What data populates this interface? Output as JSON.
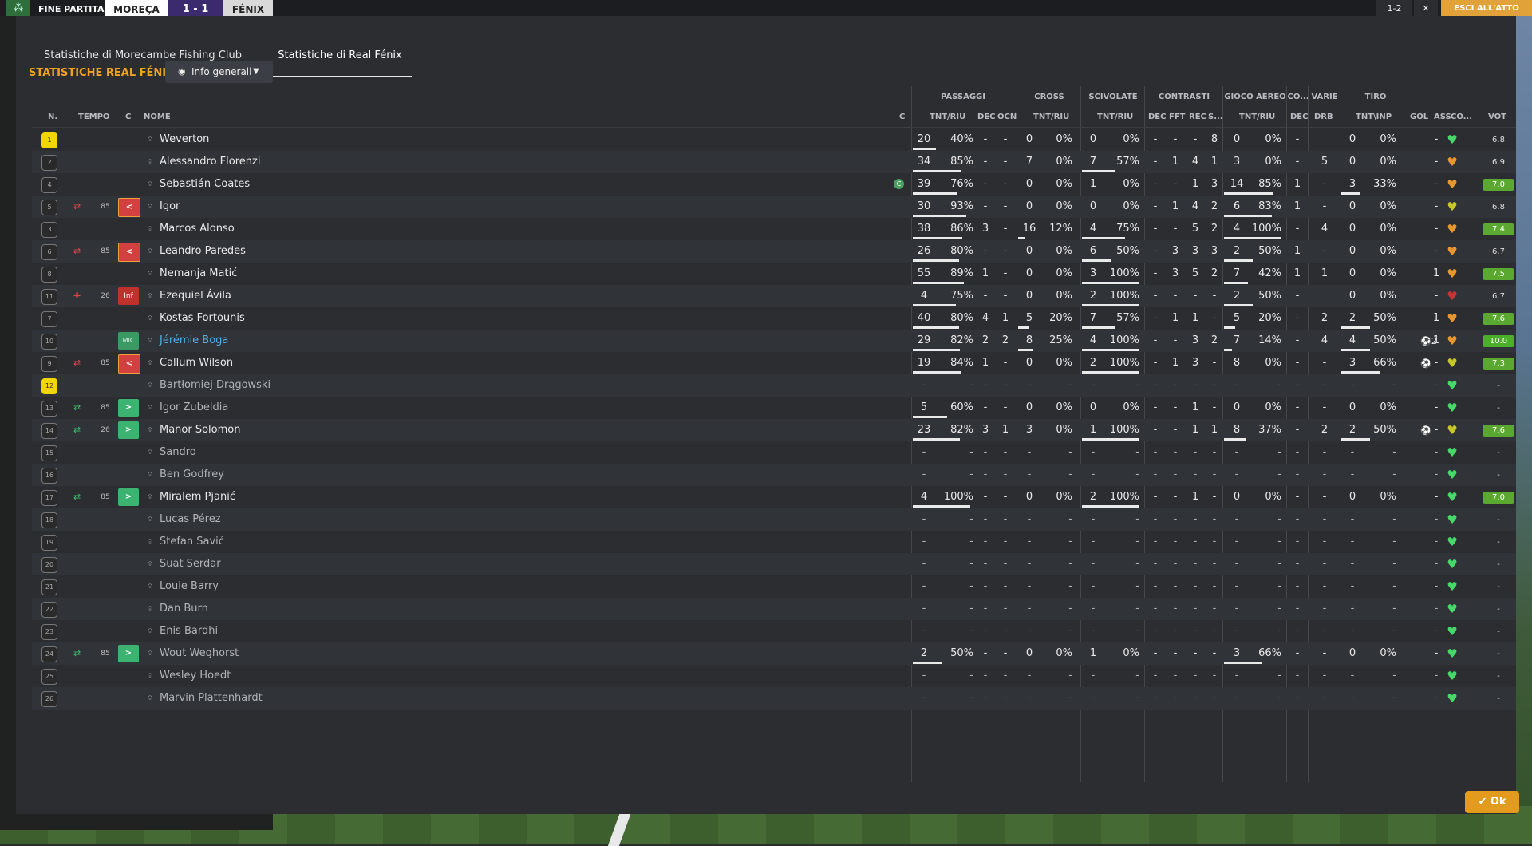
{
  "topbar": {
    "label": "FINE PARTITA",
    "home": "MOREÇA",
    "score": "1 - 1",
    "away": "FÉNIX",
    "right1": "1-2",
    "right2": "✕",
    "right3": "ESCI ALL'ATTO"
  },
  "tabs": [
    "Statistiche di Morecambe Fishing Club",
    "Statistiche di Real Fénix"
  ],
  "team_title": "STATISTICHE REAL FÉNIX",
  "dropdown": {
    "label": "Info generali"
  },
  "groups": {
    "passaggi": "PASSAGGI",
    "cross": "CROSS",
    "scivolate": "SCIVOLATE",
    "contrasti": "CONTRASTI",
    "gioco_aereo": "GIOCO AEREO",
    "co": "CO...",
    "varie": "VARIE",
    "tiro": "TIRO"
  },
  "columns": {
    "n": "N.",
    "tempo": "TEMPO",
    "c": "C",
    "nome": "NOME",
    "c2": "C",
    "pass_tr": "TNT/RIU",
    "pass_dec": "DEC",
    "pass_ocn": "OCN",
    "cross_tr": "TNT/RIU",
    "sciv_tr": "TNT/RIU",
    "con_dec": "DEC",
    "con_fft": "FFT",
    "con_rec": "REC",
    "con_s": "S...",
    "aer_tr": "TNT/RIU",
    "co_dec": "DEC",
    "var_drb": "DRB",
    "tiro_tr": "TNT\\INP",
    "gol": "GOL",
    "ass": "ASS",
    "co2": "CO...",
    "vot": "VOT"
  },
  "players": [
    {
      "n": "1",
      "gk": true,
      "sub": "",
      "min": "",
      "badge": "",
      "name": "Weverton",
      "cap": false,
      "p": [
        "20",
        "40%"
      ],
      "pd": "-",
      "po": "-",
      "cr": [
        "0",
        "0%"
      ],
      "sc": [
        "0",
        "0%"
      ],
      "cd": "-",
      "cf": "-",
      "crc": "-",
      "cs": "8",
      "ae": [
        "0",
        "0%"
      ],
      "cod": "-",
      "drb": "",
      "ti": [
        "0",
        "0%"
      ],
      "gol": "",
      "ass": "-",
      "heart": "green",
      "vot": "6.8",
      "vc": ""
    },
    {
      "n": "2",
      "gk": false,
      "sub": "",
      "min": "",
      "badge": "",
      "name": "Alessandro Florenzi",
      "cap": false,
      "p": [
        "34",
        "85%"
      ],
      "pd": "-",
      "po": "-",
      "cr": [
        "7",
        "0%"
      ],
      "sc": [
        "7",
        "57%"
      ],
      "cd": "-",
      "cf": "1",
      "crc": "4",
      "cs": "1",
      "ae": [
        "3",
        "0%"
      ],
      "cod": "-",
      "drb": "5",
      "ti": [
        "0",
        "0%"
      ],
      "gol": "",
      "ass": "-",
      "heart": "orange",
      "vot": "6.9",
      "vc": ""
    },
    {
      "n": "4",
      "gk": false,
      "sub": "",
      "min": "",
      "badge": "",
      "name": "Sebastián Coates",
      "cap": true,
      "p": [
        "39",
        "76%"
      ],
      "pd": "-",
      "po": "-",
      "cr": [
        "0",
        "0%"
      ],
      "sc": [
        "1",
        "0%"
      ],
      "cd": "-",
      "cf": "-",
      "crc": "1",
      "cs": "3",
      "ae": [
        "14",
        "85%"
      ],
      "cod": "1",
      "drb": "-",
      "ti": [
        "3",
        "33%"
      ],
      "gol": "",
      "ass": "-",
      "heart": "orange",
      "vot": "7.0",
      "vc": "g"
    },
    {
      "n": "5",
      "gk": false,
      "sub": "out",
      "min": "85",
      "badge": "red",
      "name": "Igor",
      "cap": false,
      "p": [
        "30",
        "93%"
      ],
      "pd": "-",
      "po": "-",
      "cr": [
        "0",
        "0%"
      ],
      "sc": [
        "0",
        "0%"
      ],
      "cd": "-",
      "cf": "1",
      "crc": "4",
      "cs": "2",
      "ae": [
        "6",
        "83%"
      ],
      "cod": "1",
      "drb": "-",
      "ti": [
        "0",
        "0%"
      ],
      "gol": "",
      "ass": "-",
      "heart": "yellow",
      "vot": "6.8",
      "vc": ""
    },
    {
      "n": "3",
      "gk": false,
      "sub": "",
      "min": "",
      "badge": "",
      "name": "Marcos Alonso",
      "cap": false,
      "p": [
        "38",
        "86%"
      ],
      "pd": "3",
      "po": "-",
      "cr": [
        "16",
        "12%"
      ],
      "sc": [
        "4",
        "75%"
      ],
      "cd": "-",
      "cf": "-",
      "crc": "5",
      "cs": "2",
      "ae": [
        "4",
        "100%"
      ],
      "cod": "-",
      "drb": "4",
      "ti": [
        "0",
        "0%"
      ],
      "gol": "",
      "ass": "-",
      "heart": "orange",
      "vot": "7.4",
      "vc": "g"
    },
    {
      "n": "6",
      "gk": false,
      "sub": "out",
      "min": "85",
      "badge": "red",
      "name": "Leandro Paredes",
      "cap": false,
      "p": [
        "26",
        "80%"
      ],
      "pd": "-",
      "po": "-",
      "cr": [
        "0",
        "0%"
      ],
      "sc": [
        "6",
        "50%"
      ],
      "cd": "-",
      "cf": "3",
      "crc": "3",
      "cs": "3",
      "ae": [
        "2",
        "50%"
      ],
      "cod": "1",
      "drb": "-",
      "ti": [
        "0",
        "0%"
      ],
      "gol": "",
      "ass": "-",
      "heart": "orange",
      "vot": "6.7",
      "vc": ""
    },
    {
      "n": "8",
      "gk": false,
      "sub": "",
      "min": "",
      "badge": "",
      "name": "Nemanja Matić",
      "cap": false,
      "p": [
        "55",
        "89%"
      ],
      "pd": "1",
      "po": "-",
      "cr": [
        "0",
        "0%"
      ],
      "sc": [
        "3",
        "100%"
      ],
      "cd": "-",
      "cf": "3",
      "crc": "5",
      "cs": "2",
      "ae": [
        "7",
        "42%"
      ],
      "cod": "1",
      "drb": "1",
      "ti": [
        "0",
        "0%"
      ],
      "gol": "",
      "ass": "1",
      "heart": "orange",
      "vot": "7.5",
      "vc": "g"
    },
    {
      "n": "11",
      "gk": false,
      "sub": "inj",
      "min": "26",
      "badge": "inf",
      "name": "Ezequiel Ávila",
      "cap": false,
      "p": [
        "4",
        "75%"
      ],
      "pd": "-",
      "po": "-",
      "cr": [
        "0",
        "0%"
      ],
      "sc": [
        "2",
        "100%"
      ],
      "cd": "-",
      "cf": "-",
      "crc": "-",
      "cs": "-",
      "ae": [
        "2",
        "50%"
      ],
      "cod": "-",
      "drb": "",
      "ti": [
        "0",
        "0%"
      ],
      "gol": "",
      "ass": "-",
      "heart": "red",
      "vot": "6.7",
      "vc": ""
    },
    {
      "n": "7",
      "gk": false,
      "sub": "",
      "min": "",
      "badge": "",
      "name": "Kostas Fortounis",
      "cap": false,
      "p": [
        "40",
        "80%"
      ],
      "pd": "4",
      "po": "1",
      "cr": [
        "5",
        "20%"
      ],
      "sc": [
        "7",
        "57%"
      ],
      "cd": "-",
      "cf": "1",
      "crc": "1",
      "cs": "-",
      "ae": [
        "5",
        "20%"
      ],
      "cod": "-",
      "drb": "2",
      "ti": [
        "2",
        "50%"
      ],
      "gol": "",
      "ass": "1",
      "heart": "orange",
      "vot": "7.6",
      "vc": "g"
    },
    {
      "n": "10",
      "gk": false,
      "sub": "",
      "min": "",
      "badge": "mic",
      "name": "Jérémie Boga",
      "cap": false,
      "p": [
        "29",
        "82%"
      ],
      "pd": "2",
      "po": "2",
      "cr": [
        "8",
        "25%"
      ],
      "sc": [
        "4",
        "100%"
      ],
      "cd": "-",
      "cf": "-",
      "crc": "3",
      "cs": "2",
      "ae": [
        "7",
        "14%"
      ],
      "cod": "-",
      "drb": "4",
      "ti": [
        "4",
        "50%"
      ],
      "gol": "⚽2",
      "ass": "1",
      "heart": "orange",
      "vot": "10.0",
      "vc": "gb"
    },
    {
      "n": "9",
      "gk": false,
      "sub": "out",
      "min": "85",
      "badge": "red",
      "name": "Callum Wilson",
      "cap": false,
      "p": [
        "19",
        "84%"
      ],
      "pd": "1",
      "po": "-",
      "cr": [
        "0",
        "0%"
      ],
      "sc": [
        "2",
        "100%"
      ],
      "cd": "-",
      "cf": "1",
      "crc": "3",
      "cs": "-",
      "ae": [
        "8",
        "0%"
      ],
      "cod": "-",
      "drb": "-",
      "ti": [
        "3",
        "66%"
      ],
      "gol": "⚽",
      "ass": "-",
      "heart": "yellow",
      "vot": "7.3",
      "vc": "g"
    },
    {
      "n": "12",
      "gk": true,
      "sub": "",
      "min": "",
      "badge": "",
      "name": "Bartłomiej Drągowski",
      "cap": false,
      "p": [
        "-",
        "-"
      ],
      "pd": "-",
      "po": "-",
      "cr": [
        "-",
        "-"
      ],
      "sc": [
        "-",
        "-"
      ],
      "cd": "-",
      "cf": "-",
      "crc": "-",
      "cs": "-",
      "ae": [
        "-",
        "-"
      ],
      "cod": "-",
      "drb": "-",
      "ti": [
        "-",
        "-"
      ],
      "gol": "",
      "ass": "-",
      "heart": "green",
      "vot": "-",
      "vc": ""
    },
    {
      "n": "13",
      "gk": false,
      "sub": "in",
      "min": "85",
      "badge": "green",
      "name": "Igor Zubeldia",
      "cap": false,
      "p": [
        "5",
        "60%"
      ],
      "pd": "-",
      "po": "-",
      "cr": [
        "0",
        "0%"
      ],
      "sc": [
        "0",
        "0%"
      ],
      "cd": "-",
      "cf": "-",
      "crc": "1",
      "cs": "-",
      "ae": [
        "0",
        "0%"
      ],
      "cod": "-",
      "drb": "-",
      "ti": [
        "0",
        "0%"
      ],
      "gol": "",
      "ass": "-",
      "heart": "green",
      "vot": "-",
      "vc": ""
    },
    {
      "n": "14",
      "gk": false,
      "sub": "in",
      "min": "26",
      "badge": "green",
      "name": "Manor Solomon",
      "cap": false,
      "p": [
        "23",
        "82%"
      ],
      "pd": "3",
      "po": "1",
      "cr": [
        "3",
        "0%"
      ],
      "sc": [
        "1",
        "100%"
      ],
      "cd": "-",
      "cf": "-",
      "crc": "1",
      "cs": "1",
      "ae": [
        "8",
        "37%"
      ],
      "cod": "-",
      "drb": "2",
      "ti": [
        "2",
        "50%"
      ],
      "gol": "⚽",
      "ass": "-",
      "heart": "yellow",
      "vot": "7.6",
      "vc": "g"
    },
    {
      "n": "15",
      "gk": false,
      "sub": "",
      "min": "",
      "badge": "",
      "name": "Sandro",
      "cap": false,
      "p": [
        "-",
        "-"
      ],
      "pd": "-",
      "po": "-",
      "cr": [
        "-",
        "-"
      ],
      "sc": [
        "-",
        "-"
      ],
      "cd": "-",
      "cf": "-",
      "crc": "-",
      "cs": "-",
      "ae": [
        "-",
        "-"
      ],
      "cod": "-",
      "drb": "-",
      "ti": [
        "-",
        "-"
      ],
      "gol": "",
      "ass": "-",
      "heart": "green",
      "vot": "-",
      "vc": ""
    },
    {
      "n": "16",
      "gk": false,
      "sub": "",
      "min": "",
      "badge": "",
      "name": "Ben Godfrey",
      "cap": false,
      "p": [
        "-",
        "-"
      ],
      "pd": "-",
      "po": "-",
      "cr": [
        "-",
        "-"
      ],
      "sc": [
        "-",
        "-"
      ],
      "cd": "-",
      "cf": "-",
      "crc": "-",
      "cs": "-",
      "ae": [
        "-",
        "-"
      ],
      "cod": "-",
      "drb": "-",
      "ti": [
        "-",
        "-"
      ],
      "gol": "",
      "ass": "-",
      "heart": "green",
      "vot": "-",
      "vc": ""
    },
    {
      "n": "17",
      "gk": false,
      "sub": "in",
      "min": "85",
      "badge": "green",
      "name": "Miralem Pjanić",
      "cap": false,
      "p": [
        "4",
        "100%"
      ],
      "pd": "-",
      "po": "-",
      "cr": [
        "0",
        "0%"
      ],
      "sc": [
        "2",
        "100%"
      ],
      "cd": "-",
      "cf": "-",
      "crc": "1",
      "cs": "-",
      "ae": [
        "0",
        "0%"
      ],
      "cod": "-",
      "drb": "-",
      "ti": [
        "0",
        "0%"
      ],
      "gol": "",
      "ass": "-",
      "heart": "green",
      "vot": "7.0",
      "vc": "g"
    },
    {
      "n": "18",
      "gk": false,
      "sub": "",
      "min": "",
      "badge": "",
      "name": "Lucas Pérez",
      "cap": false,
      "p": [
        "-",
        "-"
      ],
      "pd": "-",
      "po": "-",
      "cr": [
        "-",
        "-"
      ],
      "sc": [
        "-",
        "-"
      ],
      "cd": "-",
      "cf": "-",
      "crc": "-",
      "cs": "-",
      "ae": [
        "-",
        "-"
      ],
      "cod": "-",
      "drb": "-",
      "ti": [
        "-",
        "-"
      ],
      "gol": "",
      "ass": "-",
      "heart": "green",
      "vot": "-",
      "vc": ""
    },
    {
      "n": "19",
      "gk": false,
      "sub": "",
      "min": "",
      "badge": "",
      "name": "Stefan Savić",
      "cap": false,
      "p": [
        "-",
        "-"
      ],
      "pd": "-",
      "po": "-",
      "cr": [
        "-",
        "-"
      ],
      "sc": [
        "-",
        "-"
      ],
      "cd": "-",
      "cf": "-",
      "crc": "-",
      "cs": "-",
      "ae": [
        "-",
        "-"
      ],
      "cod": "-",
      "drb": "-",
      "ti": [
        "-",
        "-"
      ],
      "gol": "",
      "ass": "-",
      "heart": "green",
      "vot": "-",
      "vc": ""
    },
    {
      "n": "20",
      "gk": false,
      "sub": "",
      "min": "",
      "badge": "",
      "name": "Suat Serdar",
      "cap": false,
      "p": [
        "-",
        "-"
      ],
      "pd": "-",
      "po": "-",
      "cr": [
        "-",
        "-"
      ],
      "sc": [
        "-",
        "-"
      ],
      "cd": "-",
      "cf": "-",
      "crc": "-",
      "cs": "-",
      "ae": [
        "-",
        "-"
      ],
      "cod": "-",
      "drb": "-",
      "ti": [
        "-",
        "-"
      ],
      "gol": "",
      "ass": "-",
      "heart": "green",
      "vot": "-",
      "vc": ""
    },
    {
      "n": "21",
      "gk": false,
      "sub": "",
      "min": "",
      "badge": "",
      "name": "Louie Barry",
      "cap": false,
      "p": [
        "-",
        "-"
      ],
      "pd": "-",
      "po": "-",
      "cr": [
        "-",
        "-"
      ],
      "sc": [
        "-",
        "-"
      ],
      "cd": "-",
      "cf": "-",
      "crc": "-",
      "cs": "-",
      "ae": [
        "-",
        "-"
      ],
      "cod": "-",
      "drb": "-",
      "ti": [
        "-",
        "-"
      ],
      "gol": "",
      "ass": "-",
      "heart": "green",
      "vot": "-",
      "vc": ""
    },
    {
      "n": "22",
      "gk": false,
      "sub": "",
      "min": "",
      "badge": "",
      "name": "Dan Burn",
      "cap": false,
      "p": [
        "-",
        "-"
      ],
      "pd": "-",
      "po": "-",
      "cr": [
        "-",
        "-"
      ],
      "sc": [
        "-",
        "-"
      ],
      "cd": "-",
      "cf": "-",
      "crc": "-",
      "cs": "-",
      "ae": [
        "-",
        "-"
      ],
      "cod": "-",
      "drb": "-",
      "ti": [
        "-",
        "-"
      ],
      "gol": "",
      "ass": "-",
      "heart": "green",
      "vot": "-",
      "vc": ""
    },
    {
      "n": "23",
      "gk": false,
      "sub": "",
      "min": "",
      "badge": "",
      "name": "Enis Bardhi",
      "cap": false,
      "p": [
        "-",
        "-"
      ],
      "pd": "-",
      "po": "-",
      "cr": [
        "-",
        "-"
      ],
      "sc": [
        "-",
        "-"
      ],
      "cd": "-",
      "cf": "-",
      "crc": "-",
      "cs": "-",
      "ae": [
        "-",
        "-"
      ],
      "cod": "-",
      "drb": "-",
      "ti": [
        "-",
        "-"
      ],
      "gol": "",
      "ass": "-",
      "heart": "green",
      "vot": "-",
      "vc": ""
    },
    {
      "n": "24",
      "gk": false,
      "sub": "in",
      "min": "85",
      "badge": "green",
      "name": "Wout Weghorst",
      "cap": false,
      "p": [
        "2",
        "50%"
      ],
      "pd": "-",
      "po": "-",
      "cr": [
        "0",
        "0%"
      ],
      "sc": [
        "1",
        "0%"
      ],
      "cd": "-",
      "cf": "-",
      "crc": "-",
      "cs": "-",
      "ae": [
        "3",
        "66%"
      ],
      "cod": "-",
      "drb": "-",
      "ti": [
        "0",
        "0%"
      ],
      "gol": "",
      "ass": "-",
      "heart": "green",
      "vot": "-",
      "vc": ""
    },
    {
      "n": "25",
      "gk": false,
      "sub": "",
      "min": "",
      "badge": "",
      "name": "Wesley Hoedt",
      "cap": false,
      "p": [
        "-",
        "-"
      ],
      "pd": "-",
      "po": "-",
      "cr": [
        "-",
        "-"
      ],
      "sc": [
        "-",
        "-"
      ],
      "cd": "-",
      "cf": "-",
      "crc": "-",
      "cs": "-",
      "ae": [
        "-",
        "-"
      ],
      "cod": "-",
      "drb": "-",
      "ti": [
        "-",
        "-"
      ],
      "gol": "",
      "ass": "-",
      "heart": "green",
      "vot": "-",
      "vc": ""
    },
    {
      "n": "26",
      "gk": false,
      "sub": "",
      "min": "",
      "badge": "",
      "name": "Marvin Plattenhardt",
      "cap": false,
      "p": [
        "-",
        "-"
      ],
      "pd": "-",
      "po": "-",
      "cr": [
        "-",
        "-"
      ],
      "sc": [
        "-",
        "-"
      ],
      "cd": "-",
      "cf": "-",
      "crc": "-",
      "cs": "-",
      "ae": [
        "-",
        "-"
      ],
      "cod": "-",
      "drb": "-",
      "ti": [
        "-",
        "-"
      ],
      "gol": "",
      "ass": "-",
      "heart": "green",
      "vot": "-",
      "vc": ""
    }
  ],
  "badge_labels": {
    "red": "<",
    "green": ">",
    "inf": "Inf",
    "mic": "MIC"
  },
  "cap_letter": "C",
  "ok_label": "✔ Ok",
  "colors": {
    "accent": "#f0a31e",
    "ok": "#e29b1c",
    "highlight": "#4fb1e6",
    "vote_green": "#5aa82f"
  }
}
